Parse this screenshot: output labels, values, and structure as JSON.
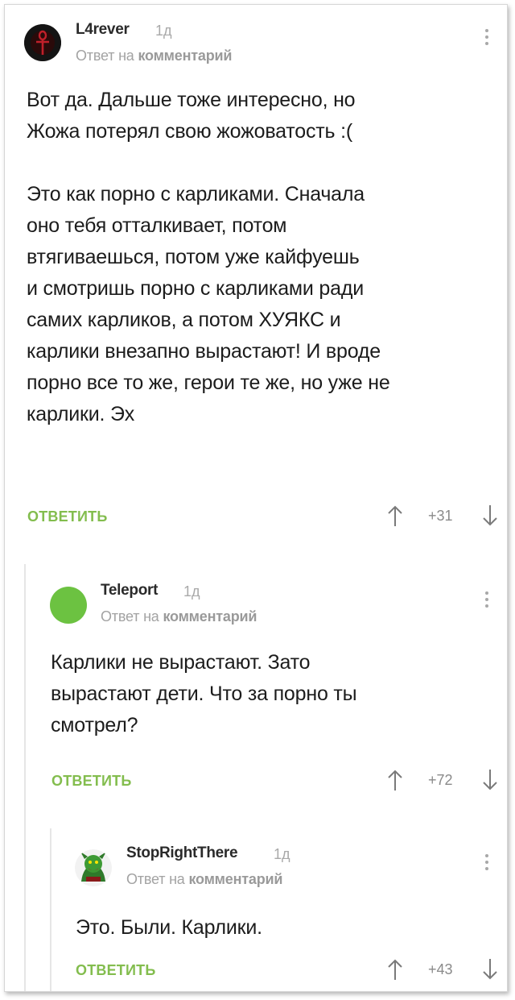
{
  "comments": [
    {
      "username": "L4rever",
      "time": "1д",
      "reply_prefix": "Ответ на",
      "reply_target": "комментарий",
      "body": "Вот да. Дальше тоже интересно, но\nЖожа потерял свою жожоватость :(\n\nЭто как порно с карликами. Сначала\nоно тебя отталкивает, потом\nвтягиваешься, потом уже кайфуешь\nи смотришь порно с карликами ради\nсамих карликов, а потом ХУЯКС и\nкарлики внезапно вырастают! И вроде\nпорно все то же, герои те же, но уже не\nкарлики. Эх",
      "reply_label": "ОТВЕТИТЬ",
      "score": "+31",
      "avatar_icon": "ankh-avatar-icon"
    },
    {
      "username": "Teleport",
      "time": "1д",
      "reply_prefix": "Ответ на",
      "reply_target": "комментарий",
      "body": "Карлики не вырастают. Зато\nвырастают дети. Что за порно ты\nсмотрел?",
      "reply_label": "ОТВЕТИТЬ",
      "score": "+72",
      "avatar_color": "#6cc241"
    },
    {
      "username": "StopRightThere",
      "time": "1д",
      "reply_prefix": "Ответ на",
      "reply_target": "комментарий",
      "body": "Это. Были. Карлики.",
      "reply_label": "ОТВЕТИТЬ",
      "score": "+43",
      "avatar_icon": "green-character-avatar-icon"
    }
  ],
  "colors": {
    "accent_green": "#83bd4e",
    "muted_text": "#a3a3a3",
    "thread_line": "#e6e6e6"
  }
}
